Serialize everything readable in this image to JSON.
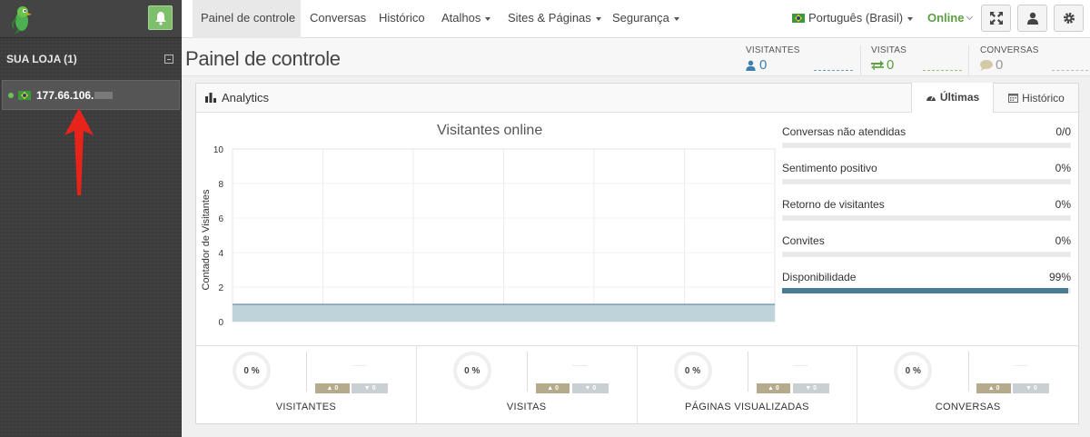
{
  "sidebar": {
    "store_label": "SUA LOJA (1)",
    "visitor_ip": "177.66.106."
  },
  "nav": {
    "items": [
      "Painel de controle",
      "Conversas",
      "Histórico",
      "Atalhos",
      "Sites & Páginas",
      "Segurança"
    ],
    "language": "Português (Brasil)",
    "status": "Online"
  },
  "header": {
    "title": "Painel de controle",
    "stats": [
      {
        "label": "VISITANTES",
        "value": "0"
      },
      {
        "label": "VISITAS",
        "value": "0"
      },
      {
        "label": "CONVERSAS",
        "value": "0"
      }
    ]
  },
  "panel": {
    "title": "Analytics",
    "tabs": [
      "Últimas",
      "Histórico"
    ]
  },
  "chart_data": {
    "type": "area",
    "title": "Visitantes online",
    "xlabel": "",
    "ylabel": "Contador de Visitantes",
    "ylim": [
      0,
      10
    ],
    "yticks": [
      0,
      2,
      4,
      6,
      8,
      10
    ],
    "grid": true,
    "series": [
      {
        "values": [
          1,
          1,
          1,
          1,
          1,
          1,
          1
        ]
      }
    ]
  },
  "metrics": [
    {
      "label": "Conversas não atendidas",
      "value": "0/0",
      "fraction": 0
    },
    {
      "label": "Sentimento positivo",
      "value": "0%",
      "fraction": 0
    },
    {
      "label": "Retorno de visitantes",
      "value": "0%",
      "fraction": 0
    },
    {
      "label": "Convites",
      "value": "0%",
      "fraction": 0
    },
    {
      "label": "Disponibilidade",
      "value": "99%",
      "fraction": 0.99
    }
  ],
  "summary": [
    {
      "label": "VISITANTES",
      "percent": "0 %",
      "up": "0",
      "down": "0"
    },
    {
      "label": "VISITAS",
      "percent": "0 %",
      "up": "0",
      "down": "0"
    },
    {
      "label": "PÁGINAS VISUALIZADAS",
      "percent": "0 %",
      "up": "0",
      "down": "0"
    },
    {
      "label": "CONVERSAS",
      "percent": "0 %",
      "up": "0",
      "down": "0"
    }
  ],
  "colors": {
    "online": "#5aa040",
    "area_fill": "#bfd3da",
    "area_line": "#4b7a94",
    "availability_bar": "#4b7a94"
  }
}
